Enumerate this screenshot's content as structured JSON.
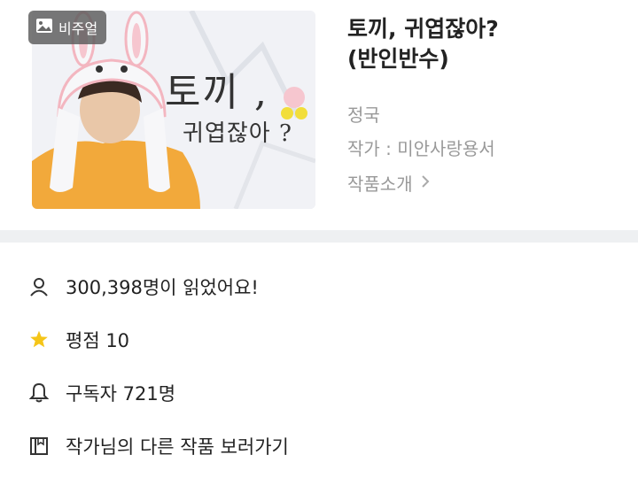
{
  "badge": {
    "label": "비주얼",
    "icon": "image-icon"
  },
  "cover": {
    "title": "토끼 ,",
    "subtitle": "귀엽잖아 ?"
  },
  "work": {
    "title_line1": "토끼, 귀엽잖아?",
    "title_line2": "(반인반수)",
    "category": "정국",
    "author": "작가 : 미안사랑용서",
    "intro_label": "작품소개"
  },
  "stats": {
    "readers": "300,398명이 읽었어요!",
    "rating": "평점 10",
    "subscribers": "구독자 721명",
    "other_works": "작가님의 다른 작품 보러가기"
  },
  "colors": {
    "star": "#f5c518",
    "muted": "#999999",
    "divider": "#eef0f2"
  }
}
